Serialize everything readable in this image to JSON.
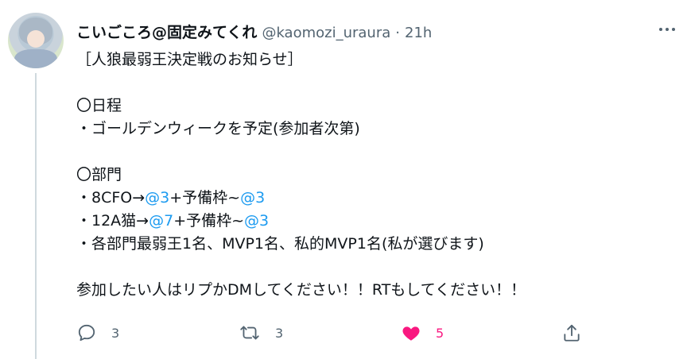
{
  "tweet": {
    "display_name": "こいごころ@固定みてくれ",
    "handle": "@kaomozi_uraura",
    "separator": "·",
    "time": "21h",
    "body": {
      "l1": "［人狼最弱王決定戦のお知らせ］",
      "l3": "〇日程",
      "l4": "・ゴールデンウィークを予定(参加者次第)",
      "l6": "〇部門",
      "l7": {
        "a": "・8CFO→",
        "b": "@3",
        "c": "+予備枠~",
        "d": "@3"
      },
      "l8": {
        "a": "・12A猫→",
        "b": "@7",
        "c": "+予備枠~",
        "d": "@3"
      },
      "l9": "・各部門最弱王1名、MVP1名、私的MVP1名(私が選びます)",
      "l11": "参加したい人はリプかDMしてください！！RTもしてください！！"
    },
    "actions": {
      "reply_count": "3",
      "retweet_count": "3",
      "like_count": "5"
    }
  },
  "icons": {
    "more": "more-horizontal-icon",
    "reply": "reply-icon",
    "retweet": "retweet-icon",
    "like": "heart-icon",
    "share": "share-icon"
  },
  "colors": {
    "text": "#0f1419",
    "secondary": "#536471",
    "mention": "#1d9bf0",
    "like": "#f91880",
    "thread_line": "#cfd9de"
  }
}
